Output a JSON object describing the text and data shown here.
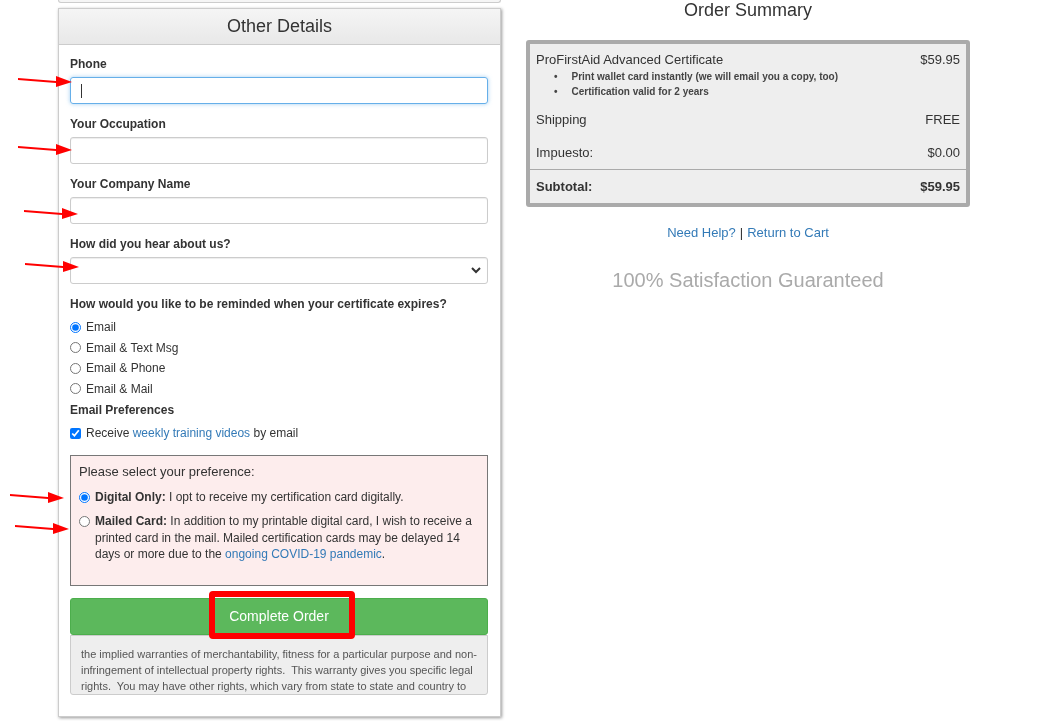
{
  "details_panel": {
    "title": "Other Details",
    "fields": [
      {
        "label": "Phone",
        "kind": "text",
        "focused": true
      },
      {
        "label": "Your Occupation",
        "kind": "text",
        "focused": false
      },
      {
        "label": "Your Company Name",
        "kind": "text",
        "focused": false
      },
      {
        "label": "How did you hear about us?",
        "kind": "select",
        "focused": false
      }
    ],
    "reminder": {
      "label": "How would you like to be reminded when your certificate expires?",
      "options": [
        {
          "label": "Email",
          "selected": true
        },
        {
          "label": "Email & Text Msg",
          "selected": false
        },
        {
          "label": "Email & Phone",
          "selected": false
        },
        {
          "label": "Email & Mail",
          "selected": false
        }
      ]
    },
    "email_preferences": {
      "label": "Email Preferences",
      "checked": true,
      "before": "Receive",
      "link": "weekly training videos",
      "after": "by email"
    },
    "card_preference": {
      "title": "Please select your preference:",
      "options": [
        {
          "name": "Digital Only:",
          "text": "I opt to receive my certification card digitally.",
          "selected": true
        },
        {
          "name": "Mailed Card:",
          "text": "In addition to my printable digital card, I wish to receive a printed card in the mail. Mailed certification cards may be delayed 14 days or more due to the",
          "link": "ongoing COVID-19 pandemic",
          "after": ".",
          "selected": false
        }
      ]
    },
    "submit": "Complete Order",
    "terms_lines": [
      "the implied warranties of merchantability, fitness for a particular purpose and non-",
      "infringement of intellectual property rights.  This warranty gives you specific legal",
      "rights.  You may have other rights, which vary from state to state and country to"
    ]
  },
  "order_summary": {
    "title": "Order Summary",
    "product": {
      "name": "ProFirstAid Advanced Certificate",
      "price": "$59.95",
      "bullet": "•",
      "features": [
        "Print wallet card instantly (we will email you a copy, too)",
        "Certification valid for 2 years"
      ]
    },
    "lines": [
      {
        "label": "Shipping",
        "value": "FREE"
      },
      {
        "label": "Impuesto:",
        "value": "$0.00"
      }
    ],
    "subtotal": {
      "label": "Subtotal:",
      "value": "$59.95"
    },
    "links": [
      {
        "label": "Need Help?"
      },
      {
        "label": "Return to Cart"
      }
    ],
    "separator": "|",
    "guarantee": "100% Satisfaction Guaranteed"
  }
}
